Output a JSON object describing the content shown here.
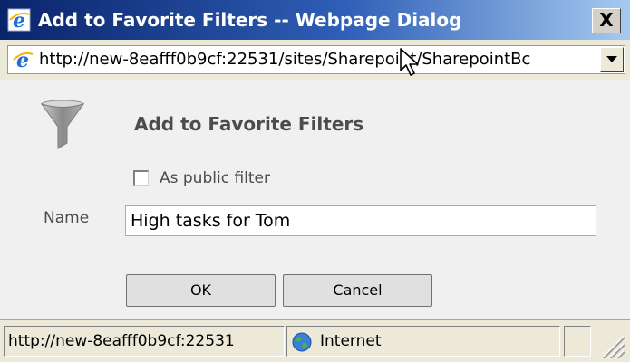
{
  "window": {
    "title": "Add to Favorite Filters -- Webpage Dialog",
    "close_label": "X",
    "address": "http://new-8eafff0b9cf:22531/sites/Sharepoint/SharepointBc"
  },
  "dialog": {
    "heading": "Add to Favorite Filters",
    "public_filter_label": "As public filter",
    "public_filter_checked": false,
    "name_label": "Name",
    "name_value": "High tasks for Tom",
    "ok_label": "OK",
    "cancel_label": "Cancel"
  },
  "statusbar": {
    "url": "http://new-8eafff0b9cf:22531",
    "zone": "Internet"
  },
  "icons": {
    "title": "ie-icon",
    "address": "ie-icon",
    "dialog": "filter-funnel-icon",
    "zone": "globe-icon",
    "pointer": "mouse-cursor"
  },
  "colors": {
    "titlebar_start": "#0a246a",
    "titlebar_end": "#a6caf0",
    "content_bg": "#f0f0f0",
    "chrome_bg": "#ece9d8"
  }
}
